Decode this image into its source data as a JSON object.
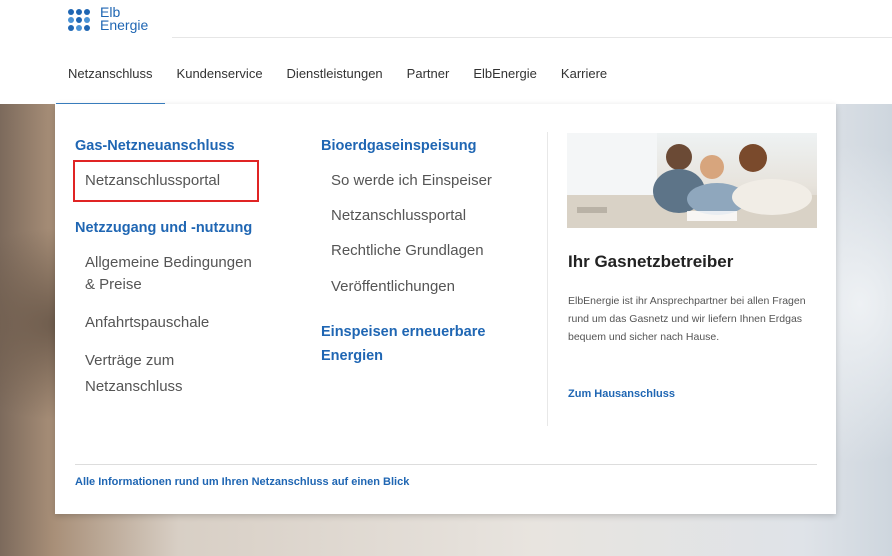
{
  "logo": {
    "line1": "Elb",
    "line2": "Energie"
  },
  "nav": {
    "items": [
      "Netzanschluss",
      "Kundenservice",
      "Dienstleistungen",
      "Partner",
      "ElbEnergie",
      "Karriere"
    ],
    "active_index": 0
  },
  "menu": {
    "col1": {
      "heading1": "Gas-Netzneuanschluss",
      "link_portal": "Netzanschlussportal",
      "heading2": "Netzzugang und -nutzung",
      "link_bedingungen_1": "Allgemeine Bedingungen",
      "link_bedingungen_2": "& Preise",
      "link_anfahrt": "Anfahrtspauschale",
      "link_vertraege_1": "Verträge zum",
      "link_vertraege_2": "Netzanschluss"
    },
    "col2": {
      "heading1": "Bioerdgaseinspeisung",
      "link_einspeiser": "So werde ich Einspeiser",
      "link_portal": "Netzanschlussportal",
      "link_grundlagen": "Rechtliche Grundlagen",
      "link_veroeffentlichungen": "Veröffentlichungen",
      "heading2_1": "Einspeisen erneuerbare",
      "heading2_2": "Energien"
    },
    "teaser": {
      "title": "Ihr Gasnetzbetreiber",
      "text": "ElbEnergie ist ihr Ansprechpartner bei allen Fragen rund um das Gasnetz und wir liefern Ihnen Erdgas bequem und sicher nach Hause.",
      "link": "Zum Hausanschluss"
    },
    "bottom_link": "Alle Informationen rund um Ihren Netzanschluss auf einen Blick"
  },
  "colors": {
    "brand_blue": "#1f66b3",
    "highlight_red": "#e02424"
  }
}
